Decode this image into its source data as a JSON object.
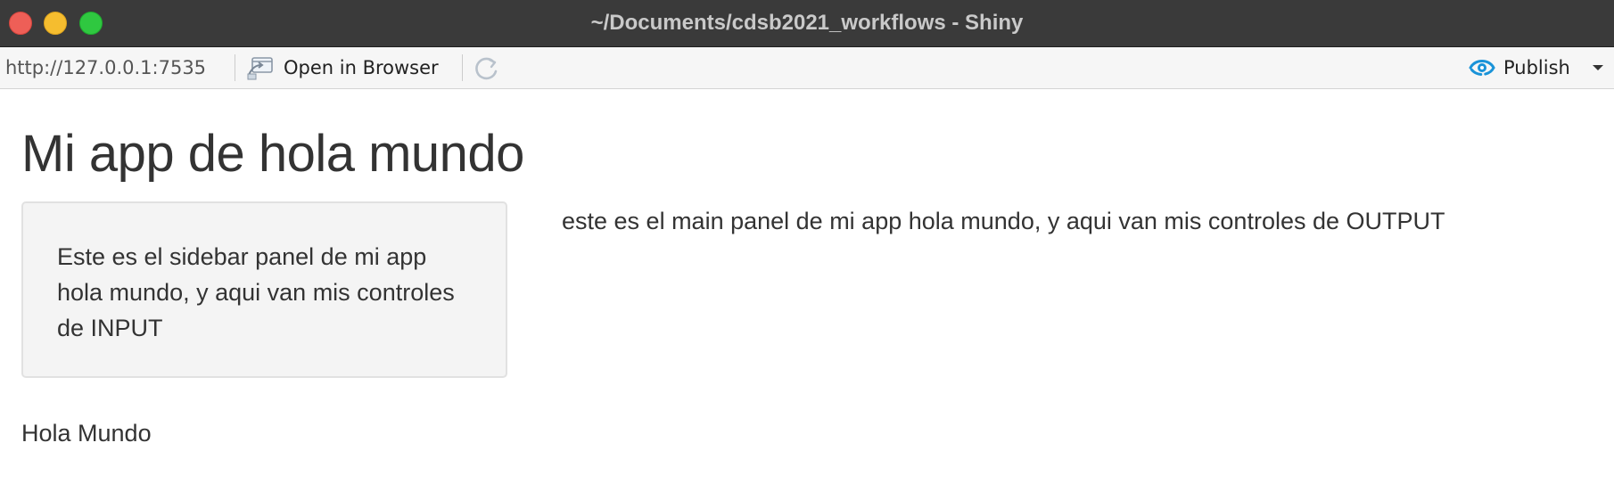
{
  "window": {
    "title": "~/Documents/cdsb2021_workflows - Shiny"
  },
  "toolbar": {
    "url": "http://127.0.0.1:7535",
    "open_in_browser_label": "Open in Browser",
    "publish_label": "Publish",
    "accent_color": "#1a93d8"
  },
  "app": {
    "title": "Mi app de hola mundo",
    "sidebar_text": "Este es el sidebar panel de mi app hola mundo, y aqui van mis controles de INPUT",
    "main_text": "este es el main panel de mi app hola mundo, y aqui van mis controles de OUTPUT",
    "footer_text": "Hola Mundo"
  }
}
